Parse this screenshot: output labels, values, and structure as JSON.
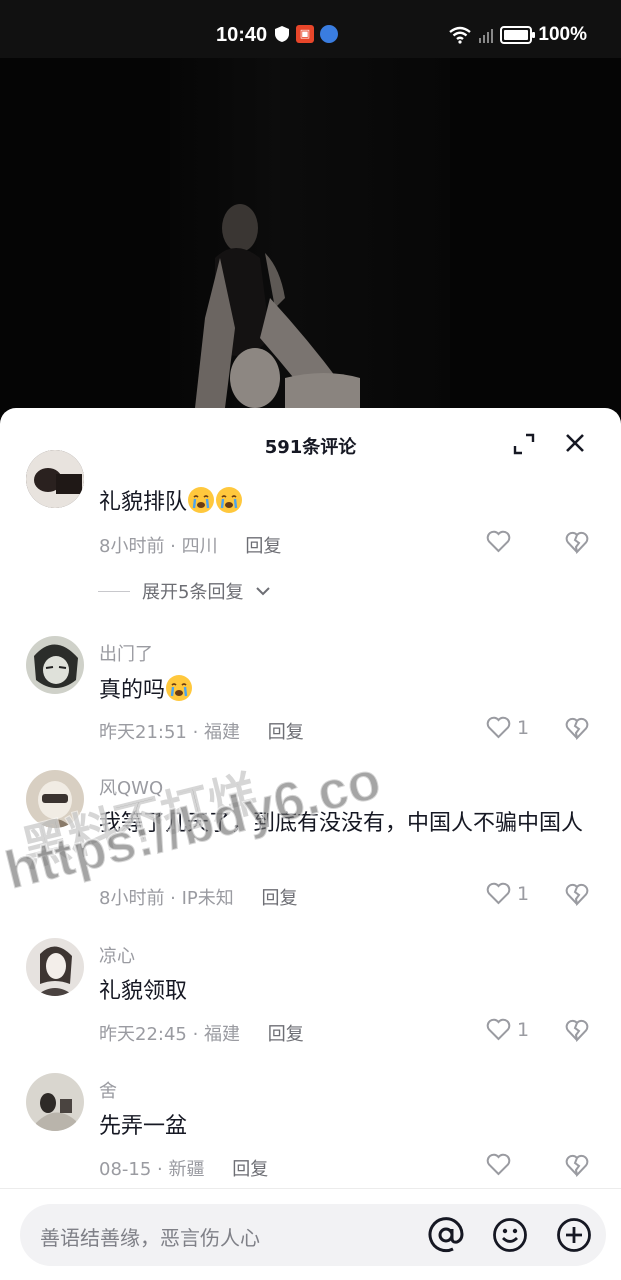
{
  "status_bar": {
    "time": "10:40",
    "battery": "100%",
    "battery_level": 1.0
  },
  "panel": {
    "title": "591条评论"
  },
  "comments": [
    {
      "username": "",
      "text": "礼貌排队",
      "emoji_count": 2,
      "time": "8小时前",
      "location": "四川",
      "reply": "回复",
      "likes": "",
      "expand_replies": "展开5条回复"
    },
    {
      "username": "出门了",
      "text": "真的吗",
      "emoji_count": 1,
      "time": "昨天21:51",
      "location": "福建",
      "reply": "回复",
      "likes": "1"
    },
    {
      "username": "风QWQ",
      "text": "我等了几天了，到底有没没有，中国人不骗中国人",
      "time": "8小时前",
      "location": "IP未知",
      "reply": "回复",
      "likes": "1"
    },
    {
      "username": "凉心",
      "text": "礼貌领取",
      "time": "昨天22:45",
      "location": "福建",
      "reply": "回复",
      "likes": "1"
    },
    {
      "username": "舍",
      "text": "先弄一盆",
      "time": "08-15",
      "location": "新疆",
      "reply": "回复",
      "likes": ""
    }
  ],
  "input": {
    "placeholder": "善语结善缘，恶言伤人心"
  },
  "watermark": {
    "line1": "黑料不打烊",
    "line2": "https://bdy6.co"
  },
  "colors": {
    "panel_bg": "#ffffff",
    "text_primary": "#161823",
    "text_secondary": "#9a9ba1"
  }
}
